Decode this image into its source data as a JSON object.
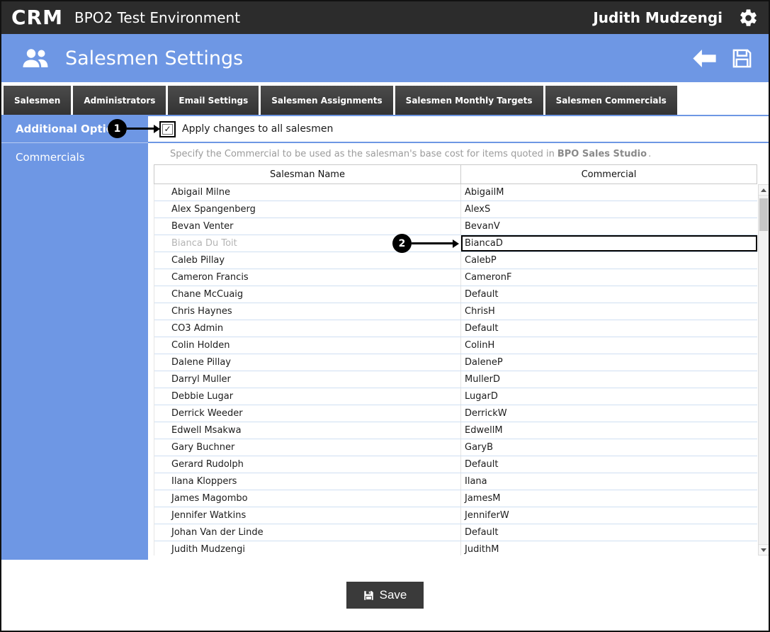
{
  "topbar": {
    "logo": "CRM",
    "app_title": "BPO2 Test Environment",
    "user_name": "Judith Mudzengi"
  },
  "header": {
    "title": "Salesmen Settings"
  },
  "tabs": [
    {
      "label": "Salesmen"
    },
    {
      "label": "Administrators"
    },
    {
      "label": "Email Settings"
    },
    {
      "label": "Salesmen Assignments"
    },
    {
      "label": "Salesmen Monthly Targets"
    },
    {
      "label": "Salesmen Commercials"
    }
  ],
  "sidebar": {
    "items": [
      {
        "label": "Additional Options"
      },
      {
        "label": "Commercials"
      }
    ]
  },
  "additional_options": {
    "callout_number": "1",
    "checkbox_checked": true,
    "checkbox_glyph": "✓",
    "label": "Apply changes to all salesmen"
  },
  "commercials": {
    "description_prefix": "Specify the Commercial to be used as the salesman's base cost for items quoted in",
    "description_bold": "BPO Sales Studio",
    "description_suffix": ".",
    "callout_number": "2",
    "table": {
      "columns": [
        "Salesman Name",
        "Commercial"
      ],
      "rows": [
        {
          "name": "Abigail Milne",
          "commercial": "AbigailM"
        },
        {
          "name": "Alex Spangenberg",
          "commercial": "AlexS"
        },
        {
          "name": "Bevan Venter",
          "commercial": "BevanV"
        },
        {
          "name": "Bianca Du Toit",
          "commercial": "BiancaD",
          "muted": true,
          "highlighted": true
        },
        {
          "name": "Caleb Pillay",
          "commercial": "CalebP"
        },
        {
          "name": "Cameron Francis",
          "commercial": "CameronF"
        },
        {
          "name": "Chane McCuaig",
          "commercial": "Default"
        },
        {
          "name": "Chris Haynes",
          "commercial": "ChrisH"
        },
        {
          "name": "CO3 Admin",
          "commercial": "Default"
        },
        {
          "name": "Colin Holden",
          "commercial": "ColinH"
        },
        {
          "name": "Dalene Pillay",
          "commercial": "DaleneP"
        },
        {
          "name": "Darryl Muller",
          "commercial": "MullerD"
        },
        {
          "name": "Debbie Lugar",
          "commercial": "LugarD"
        },
        {
          "name": "Derrick Weeder",
          "commercial": "DerrickW"
        },
        {
          "name": "Edwell Msakwa",
          "commercial": "EdwellM"
        },
        {
          "name": "Gary Buchner",
          "commercial": "GaryB"
        },
        {
          "name": "Gerard Rudolph",
          "commercial": "Default"
        },
        {
          "name": "Ilana Kloppers",
          "commercial": "Ilana"
        },
        {
          "name": "James Magombo",
          "commercial": "JamesM"
        },
        {
          "name": "Jennifer Watkins",
          "commercial": "JenniferW"
        },
        {
          "name": "Johan Van der Linde",
          "commercial": "Default"
        },
        {
          "name": "Judith Mudzengi",
          "commercial": "JudithM"
        }
      ]
    }
  },
  "footer": {
    "save_label": "Save"
  },
  "colors": {
    "accent_blue": "#6e97e4",
    "topbar_dark": "#2c2c2c",
    "tab_dark": "#3f3f3f",
    "row_divider": "#cfdff2",
    "callout_black": "#000000"
  }
}
